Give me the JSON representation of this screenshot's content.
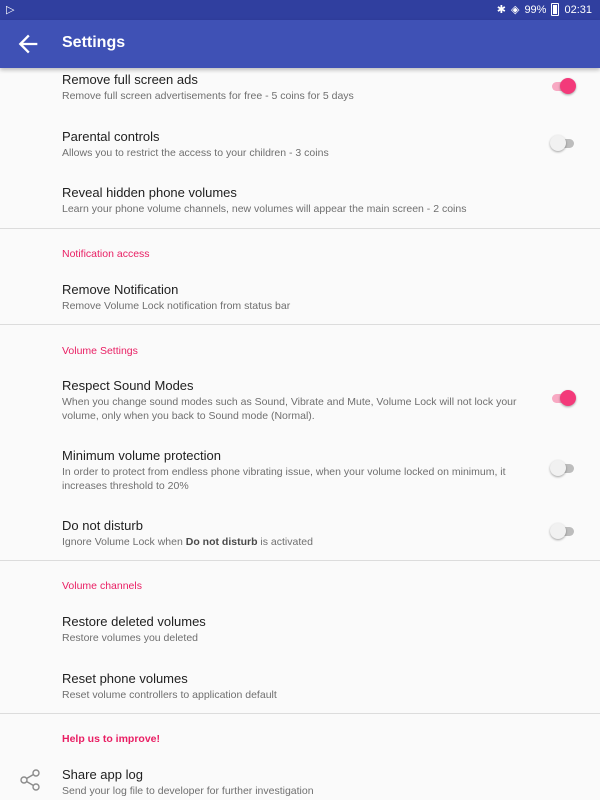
{
  "status_bar": {
    "left_glyph": "▷",
    "bluetooth_glyph": "✱",
    "wifi_glyph": "◈",
    "battery": "99%",
    "time": "02:31"
  },
  "appbar": {
    "title": "Settings"
  },
  "items": {
    "remove_ads": {
      "title": "Remove full screen ads",
      "summary": "Remove full screen advertisements for free - 5 coins for 5 days",
      "enabled": true
    },
    "parental": {
      "title": "Parental controls",
      "summary": "Allows you to restrict the access to your children - 3 coins",
      "enabled": false
    },
    "reveal": {
      "title": "Reveal hidden phone volumes",
      "summary": "Learn your phone volume channels, new volumes will appear the main screen - 2 coins"
    },
    "remove_notification": {
      "title": "Remove Notification",
      "summary": "Remove Volume Lock notification from status bar"
    },
    "respect_sound": {
      "title": "Respect Sound Modes",
      "summary": "When you change sound modes such as Sound, Vibrate and Mute, Volume Lock will not lock your volume, only when you back to Sound mode (Normal).",
      "enabled": true
    },
    "min_volume": {
      "title": "Minimum volume protection",
      "summary": "In order to protect from endless phone vibrating issue, when your volume locked on minimum, it increases threshold to 20%",
      "enabled": false
    },
    "dnd": {
      "title": "Do not disturb",
      "summary_pre": "Ignore Volume Lock when ",
      "summary_bold": "Do not disturb",
      "summary_post": " is activated",
      "enabled": false
    },
    "restore": {
      "title": "Restore deleted volumes",
      "summary": "Restore volumes you deleted"
    },
    "reset": {
      "title": "Reset phone volumes",
      "summary": "Reset volume controllers to application default"
    },
    "share_log": {
      "title": "Share app log",
      "summary": "Send your log file to developer for further investigation"
    }
  },
  "sections": {
    "notification": "Notification access",
    "volume_settings": "Volume Settings",
    "volume_channels": "Volume channels",
    "help": "Help us to improve!"
  },
  "colors": {
    "primary": "#3f51b5",
    "primary_dark": "#303f9f",
    "accent": "#e91e63"
  },
  "icons": {
    "back": "arrow-left-icon",
    "share": "share-icon"
  }
}
